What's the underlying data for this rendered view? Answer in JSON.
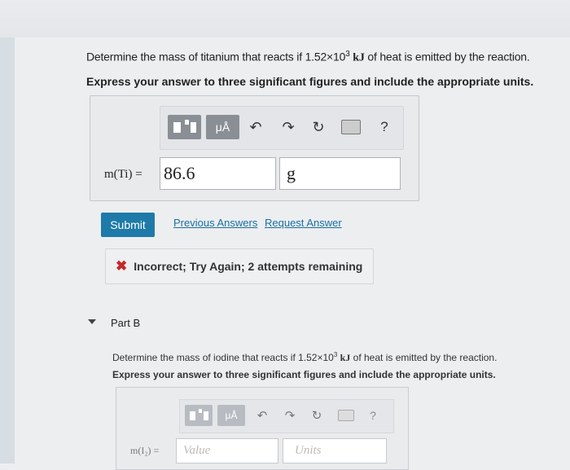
{
  "part_a": {
    "question_prefix": "Determine the mass of titanium that reacts if 1.52×10",
    "question_exponent": "3",
    "question_unit": "kJ",
    "question_suffix": "of heat is emitted by the reaction.",
    "instruction": "Express your answer to three significant figures and include the appropriate units.",
    "toolbar": {
      "units_label": "μÅ",
      "undo_glyph": "↶",
      "redo_glyph": "↷",
      "reset_glyph": "↻",
      "help_label": "?"
    },
    "variable_label": "m(Ti) =",
    "answer_value": "86.6",
    "answer_units": "g",
    "submit_label": "Submit",
    "previous_answers_label": "Previous Answers",
    "request_answer_label": "Request Answer",
    "feedback_icon": "✖",
    "feedback_message": "Incorrect; Try Again; 2 attempts remaining"
  },
  "part_b": {
    "label": "Part B",
    "question_prefix": "Determine the mass of iodine that reacts if 1.52×10",
    "question_exponent": "3",
    "question_unit": "kJ",
    "question_suffix": "of heat is emitted by the reaction.",
    "instruction": "Express your answer to three significant figures and include the appropriate units.",
    "toolbar": {
      "units_label": "μÅ",
      "undo_glyph": "↶",
      "redo_glyph": "↷",
      "reset_glyph": "↻",
      "help_label": "?"
    },
    "variable_label": "m(I₂) =",
    "value_placeholder": "Value",
    "units_placeholder": "Units"
  },
  "colors": {
    "submit": "#1e7aa8",
    "link": "#1a6fa0",
    "error": "#c62828"
  }
}
